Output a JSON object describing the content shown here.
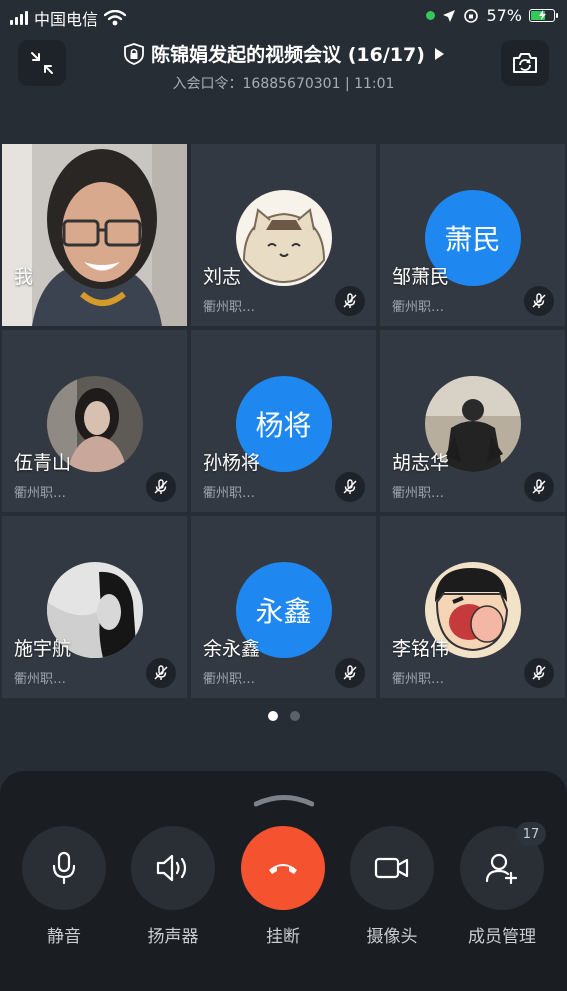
{
  "status_bar": {
    "carrier": "中国电信",
    "battery": "57%",
    "battery_level": 0.57
  },
  "header": {
    "title": "陈锦娟发起的视频会议 (16/17)",
    "subtitle": "入会口令：16885670301 | 11:01",
    "icons": [
      "collapse-icon",
      "lock-icon",
      "play-icon",
      "switch-camera-icon"
    ]
  },
  "participants": [
    {
      "name": "我",
      "org": "",
      "avatar": "photo-self",
      "muted": false
    },
    {
      "name": "刘志",
      "org": "衢州职…",
      "avatar": "cartoon-cat",
      "muted": true
    },
    {
      "name": "邹萧民",
      "org": "衢州职…",
      "avatar_text": "萧民",
      "muted": true
    },
    {
      "name": "伍青山",
      "org": "衢州职…",
      "avatar": "photo-girl",
      "muted": true
    },
    {
      "name": "孙杨将",
      "org": "衢州职…",
      "avatar_text": "杨将",
      "muted": true
    },
    {
      "name": "胡志华",
      "org": "衢州职…",
      "avatar": "photo-sitting",
      "muted": true
    },
    {
      "name": "施宇航",
      "org": "衢州职…",
      "avatar": "photo-bw",
      "muted": true
    },
    {
      "name": "余永鑫",
      "org": "衢州职…",
      "avatar_text": "永鑫",
      "muted": true
    },
    {
      "name": "李铭伟",
      "org": "衢州职…",
      "avatar": "cartoon-shinchan",
      "muted": true
    }
  ],
  "pager": {
    "pages": 2,
    "current": 1
  },
  "controls": {
    "mute": "静音",
    "speaker": "扬声器",
    "hangup": "挂断",
    "camera": "摄像头",
    "members": "成员管理",
    "member_count": "17"
  },
  "colors": {
    "background": "#272d35",
    "tile": "#333942",
    "avatar_blue": "#1f87f0",
    "hangup_red": "#f5532f",
    "battery_green": "#34c759"
  }
}
